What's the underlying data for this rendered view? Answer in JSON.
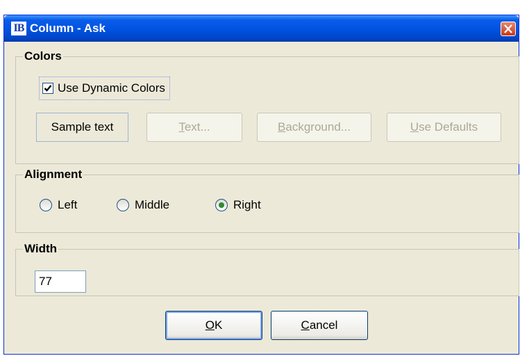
{
  "window": {
    "app_icon_text": "IB",
    "title": "Column - Ask"
  },
  "colors_group": {
    "title": "Colors",
    "use_dynamic_colors": {
      "label": "Use Dynamic Colors",
      "checked": true
    },
    "sample_text": "Sample text",
    "text_button": {
      "mnemonic": "T",
      "rest": "ext..."
    },
    "background_button": {
      "mnemonic": "B",
      "rest": "ackground..."
    },
    "defaults_button": {
      "mnemonic": "U",
      "rest": "se Defaults"
    }
  },
  "alignment_group": {
    "title": "Alignment",
    "options": [
      "Left",
      "Middle",
      "Right"
    ],
    "selected": "Right"
  },
  "width_group": {
    "title": "Width",
    "value": "77"
  },
  "buttons": {
    "ok": {
      "mnemonic": "O",
      "rest": "K"
    },
    "cancel": {
      "mnemonic": "C",
      "rest": "ancel"
    }
  },
  "colors_theme": {
    "title_bar": "#0054e3",
    "dialog_bg": "#ece9d8",
    "close_button": "#c8381a"
  }
}
